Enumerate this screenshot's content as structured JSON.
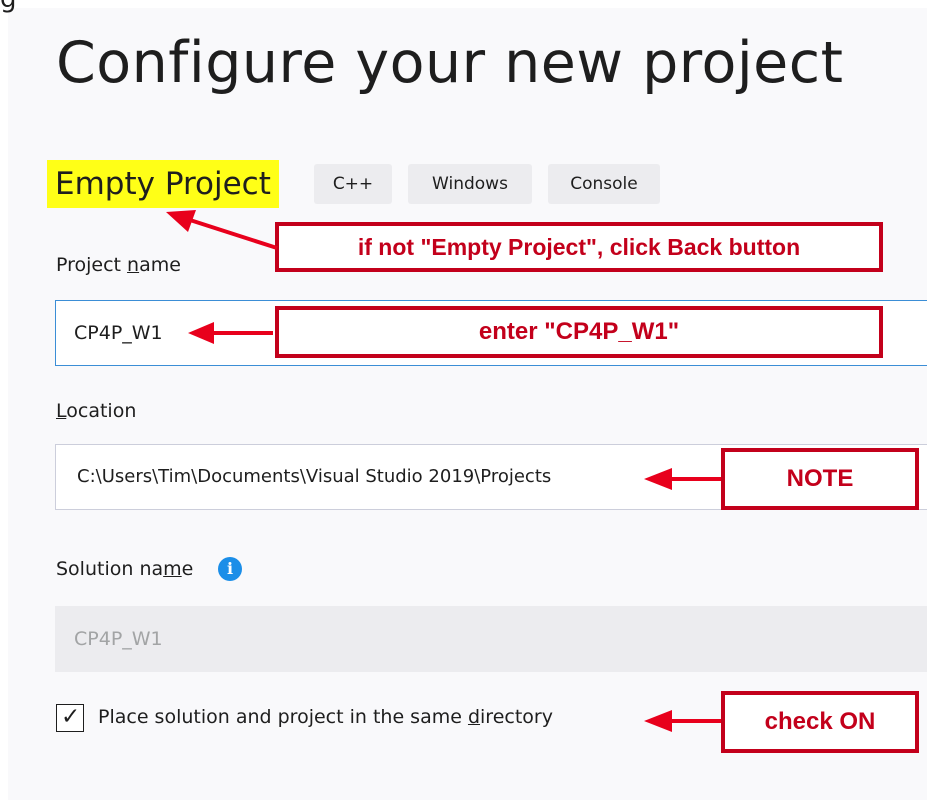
{
  "clipped_heading": "g",
  "header": {
    "title": "Configure your new project"
  },
  "template": {
    "name": "Empty Project",
    "tags": [
      "C++",
      "Windows",
      "Console"
    ]
  },
  "project_name": {
    "label_prefix": "Project ",
    "label_underlined": "n",
    "label_suffix": "ame",
    "value": "CP4P_W1"
  },
  "location": {
    "label_underlined": "L",
    "label_suffix": "ocation",
    "value": "C:\\Users\\Tim\\Documents\\Visual Studio 2019\\Projects"
  },
  "solution_name": {
    "label_prefix": "Solution na",
    "label_underlined": "m",
    "label_suffix": "e",
    "info_icon_glyph": "i",
    "value": "CP4P_W1"
  },
  "same_directory": {
    "label_prefix": "Place solution and project in the same ",
    "label_underlined": "d",
    "label_suffix": "irectory",
    "checked": true,
    "check_glyph": "✓"
  },
  "annotations": {
    "back_hint": "if not \"Empty Project\", click Back button",
    "enter_hint": "enter \"CP4P_W1\"",
    "note": "NOTE",
    "check_on": "check ON"
  },
  "colors": {
    "annotation_red": "#c3001b",
    "arrow_red": "#e8001c",
    "highlight_yellow": "#ffff17",
    "focus_blue": "#3b8ed6",
    "info_blue": "#1b8ee8"
  }
}
